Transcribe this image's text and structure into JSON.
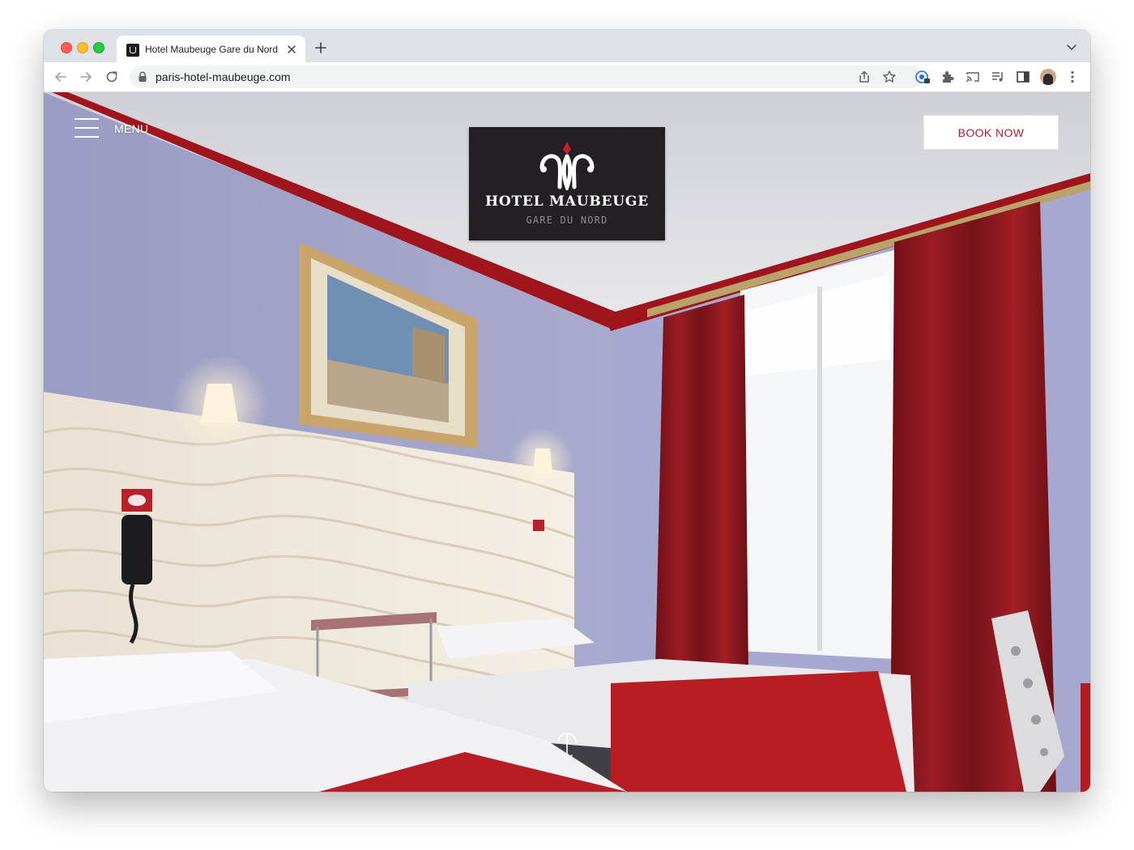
{
  "browser": {
    "tab_title": "Hotel Maubeuge Gare du Nord",
    "url": "paris-hotel-maubeuge.com",
    "icons": [
      "back-arrow-icon",
      "forward-arrow-icon",
      "reload-icon",
      "lock-icon",
      "share-icon",
      "bookmark-star-icon",
      "password-manager-icon",
      "extensions-icon",
      "cast-icon",
      "media-controls-icon",
      "side-panel-icon",
      "profile-avatar",
      "more-menu-icon"
    ]
  },
  "header": {
    "menu_label": "MENU",
    "book_label": "BOOK NOW"
  },
  "logo": {
    "name": "HOTEL MAUBEUGE",
    "subtitle": "GARE DU NORD"
  },
  "colors": {
    "accent": "#b01f2c",
    "logo_background": "#231f24",
    "curtain_red": "#8e1a1f",
    "wall_lavender": "#a6a7cb"
  }
}
